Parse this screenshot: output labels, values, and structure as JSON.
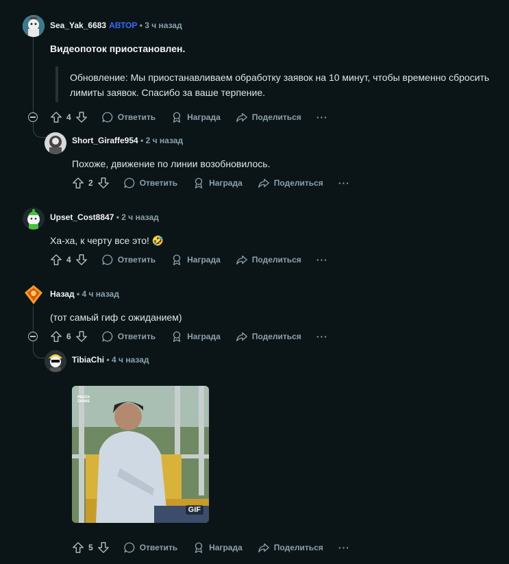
{
  "comments": [
    {
      "author": "Sea_Yak_6683",
      "op_badge": "АВТОР",
      "time": "3 ч назад",
      "title": "Видеопоток приостановлен.",
      "quote": "Обновление: Мы приостанавливаем обработку заявок на 10 минут, чтобы временно сбросить лимиты заявок. Спасибо за ваше терпение.",
      "votes": "4"
    },
    {
      "author": "Short_Giraffe954",
      "time": "2 ч назад",
      "text": "Похоже, движение по линии возобновилось.",
      "votes": "2"
    },
    {
      "author": "Upset_Cost8847",
      "time": "2 ч назад",
      "text": "Ха-ха, к черту все это!",
      "votes": "4"
    },
    {
      "author": "Назад",
      "time": "4 ч назад",
      "text": "(тот самый гиф с ожиданием)",
      "votes": "6"
    },
    {
      "author": "TibiaChi",
      "time": "4 ч назад",
      "gif_badge": "GIF",
      "gif_watermark": "PIRATA FARMS",
      "votes": "5"
    }
  ],
  "actions": {
    "reply": "Ответить",
    "award": "Награда",
    "share": "Поделиться",
    "more": "···"
  },
  "separator": "•",
  "emoji": "🤣",
  "icons": [
    "upvote-icon",
    "downvote-icon",
    "comment-icon",
    "award-icon",
    "share-icon",
    "more-icon",
    "collapse-icon"
  ]
}
